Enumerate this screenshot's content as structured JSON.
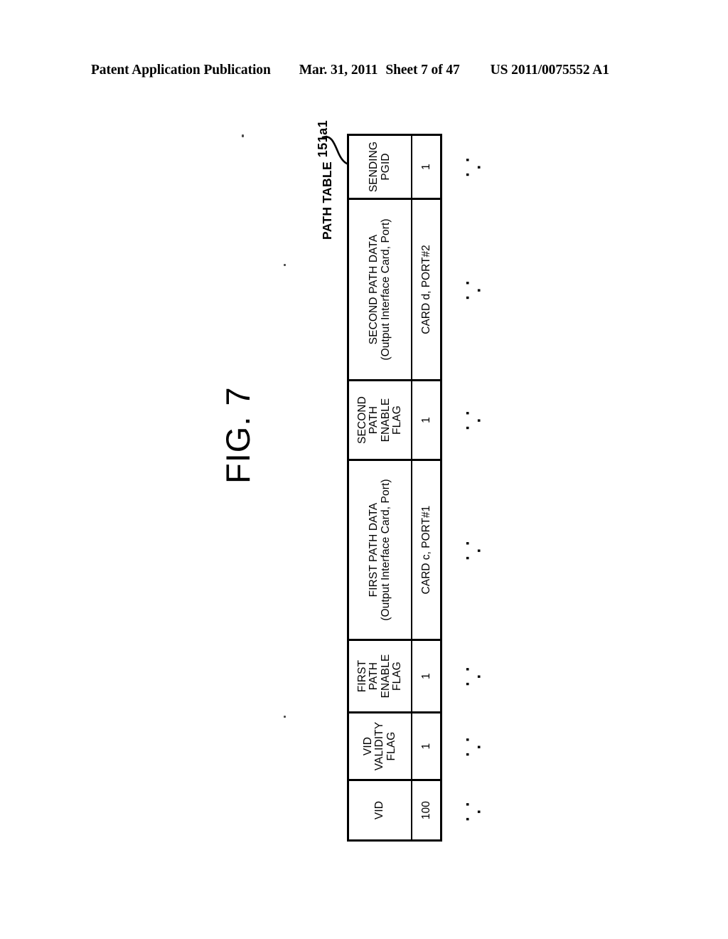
{
  "header": {
    "publication": "Patent Application Publication",
    "date": "Mar. 31, 2011",
    "sheet": "Sheet 7 of 47",
    "pub_number": "US 2011/0075552 A1"
  },
  "figure": {
    "label": "FIG. 7",
    "caption": "PATH TABLE",
    "reference_numeral": "151a1"
  },
  "table": {
    "name": "PATH TABLE",
    "ellipsis": "· · ·",
    "columns": [
      {
        "header": "VID",
        "value": "100",
        "more": "· · ·"
      },
      {
        "header": "VID\nVALIDITY\nFLAG",
        "value": "1",
        "more": "· · ·"
      },
      {
        "header": "FIRST\nPATH\nENABLE\nFLAG",
        "value": "1",
        "more": "· · ·"
      },
      {
        "header": "FIRST PATH DATA\n(Output Interface Card, Port)",
        "value": "CARD c, PORT#1",
        "more": "· · ·"
      },
      {
        "header": "SECOND\nPATH\nENABLE\nFLAG",
        "value": "1",
        "more": "· · ·"
      },
      {
        "header": "SECOND PATH DATA\n(Output Interface Card, Port)",
        "value": "CARD d, PORT#2",
        "more": "· · ·"
      },
      {
        "header": "SENDING\nPGID",
        "value": "1",
        "more": "· · ·"
      }
    ]
  },
  "colors": {
    "ink": "#000000",
    "paper": "#ffffff"
  }
}
